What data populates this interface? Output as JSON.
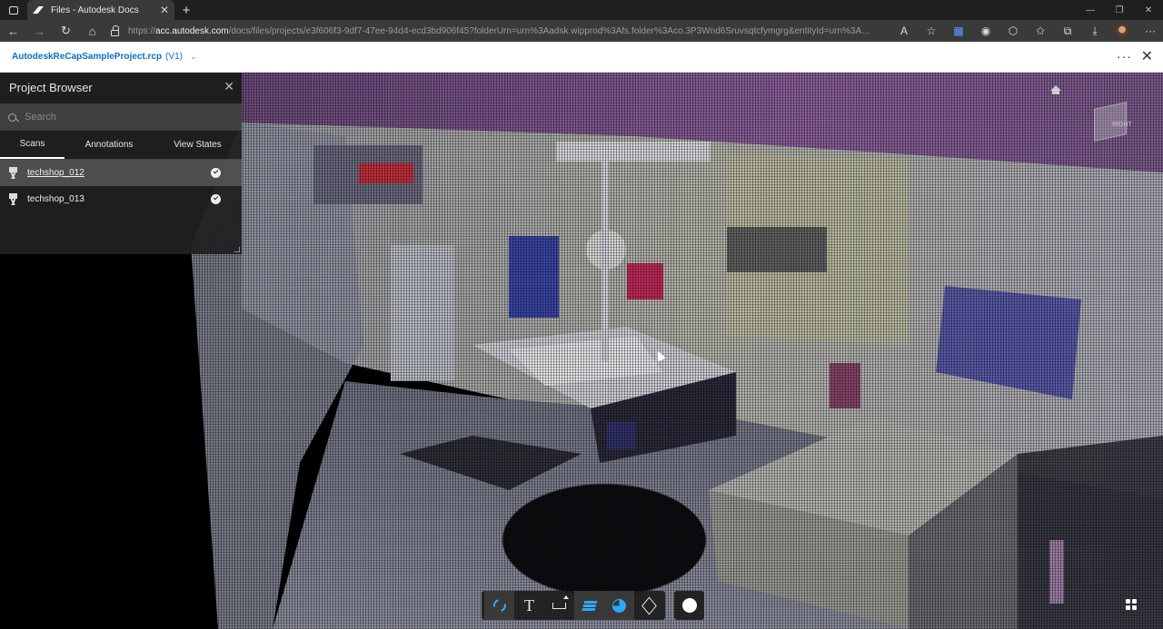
{
  "browser": {
    "tab_title": "Files - Autodesk Docs",
    "new_tab_label": "+",
    "url_prefix": "https://",
    "url_domain": "acc.autodesk.com",
    "url_rest": "/docs/files/projects/e3f606f3-9df7-47ee-94d4-ecd3bd906f45?folderUrn=urn%3Aadsk.wipprod%3Afs.folder%3Aco.3P3Wnd6Sruvsqtcfymgrg&entityId=urn%3Aadsk.wippro..."
  },
  "header": {
    "file_name": "AutodeskReCapSampleProject.rcp",
    "version": "(V1)"
  },
  "project_browser": {
    "title": "Project Browser",
    "search_placeholder": "Search",
    "tabs": [
      {
        "label": "Scans",
        "active": true
      },
      {
        "label": "Annotations",
        "active": false
      },
      {
        "label": "View States",
        "active": false
      }
    ],
    "scans": [
      {
        "name": "techshop_012",
        "selected": true,
        "visible": true
      },
      {
        "name": "techshop_013",
        "selected": false,
        "visible": true
      }
    ]
  },
  "viewcube": {
    "face_label": "RIGHT"
  },
  "toolbar": {
    "tools": [
      "orbit-icon",
      "text-annotation-icon",
      "measure-icon",
      "layers-icon",
      "point-color-icon",
      "cube-view-icon",
      "render-circle-icon"
    ]
  },
  "colors": {
    "link_blue": "#0a6fcf",
    "tool_active_blue": "#2fa8ff",
    "panel_bg": "#202020"
  }
}
